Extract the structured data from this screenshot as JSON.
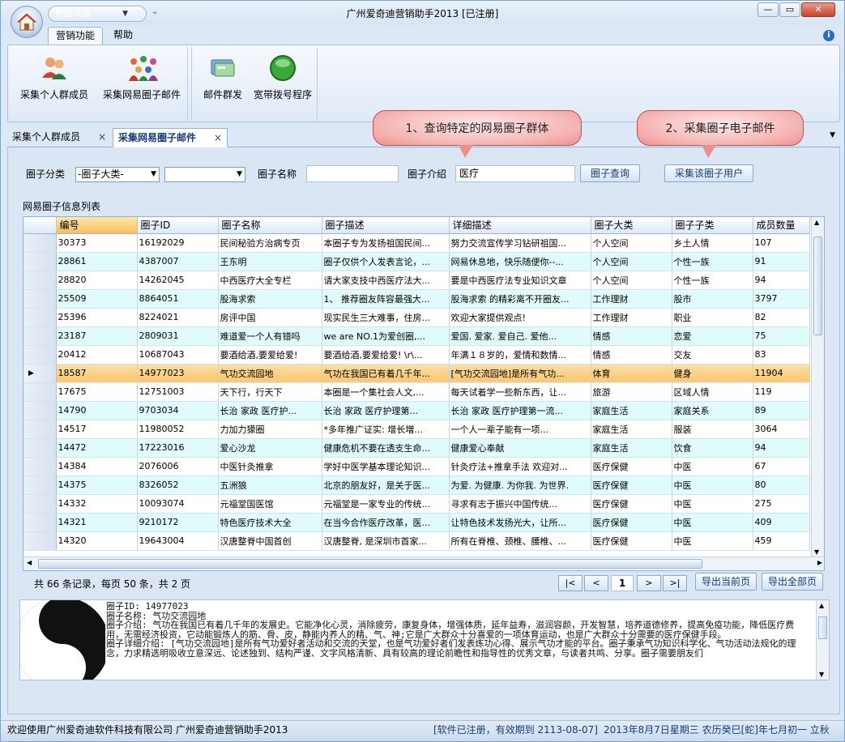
{
  "app": {
    "title": "广州爱奇迪营销助手2013 [已注册]",
    "qat_text": "界面风格"
  },
  "ribbon_tabs": [
    {
      "label": "营销功能",
      "active": true
    },
    {
      "label": "帮助",
      "active": false
    }
  ],
  "ribbon_buttons": [
    {
      "label": "采集个人群成员",
      "icon": "people-icon"
    },
    {
      "label": "采集网易圈子邮件",
      "icon": "group-people-icon"
    },
    {
      "label": "邮件群发",
      "icon": "email-cards-icon"
    },
    {
      "label": "宽带拨号程序",
      "icon": "green-orb-icon"
    }
  ],
  "doc_tabs": [
    {
      "label": "采集个人群成员",
      "active": false
    },
    {
      "label": "采集网易圈子邮件",
      "active": true
    }
  ],
  "callouts": [
    "1、查询特定的网易圈子群体",
    "2、采集圈子电子邮件"
  ],
  "filters": {
    "category_label": "圈子分类",
    "category_value": "-圈子大类-",
    "subcategory_value": "",
    "name_label": "圈子名称",
    "name_value": "",
    "intro_label": "圈子介绍",
    "intro_value": "医疗",
    "query_button": "圈子查询",
    "collect_button": "采集该圈子用户"
  },
  "grid": {
    "title": "网易圈子信息列表",
    "columns": [
      "编号",
      "圈子ID",
      "圈子名称",
      "圈子描述",
      "详细描述",
      "圈子大类",
      "圈子子类",
      "成员数量"
    ],
    "rows": [
      [
        "30373",
        "16192029",
        "民间秘验方治病专页",
        "本圈子专为发扬祖国民间...",
        "努力交流宣传学习钻研祖国...",
        "个人空间",
        "乡土人情",
        "107"
      ],
      [
        "28861",
        "4387007",
        "王东明",
        "圈子仅供个人发表言论，...",
        "网易休息地，快乐随便你--...",
        "个人空间",
        "个性一族",
        "91"
      ],
      [
        "28820",
        "14262045",
        "中西医疗大全专栏",
        "请大家支技中西医疗法大...",
        "要是中西医疗法专业知识文章",
        "个人空间",
        "个性一族",
        "94"
      ],
      [
        "25509",
        "8864051",
        "股海求索",
        "1、 推荐圈友阵容最强大...",
        "股海求索 的精彩离不开圈友...",
        "工作理财",
        "股市",
        "3797"
      ],
      [
        "25396",
        "8224021",
        "房评中国",
        "现实民生三大难事，住房...",
        "欢迎大家提供观点!",
        "工作理财",
        "职业",
        "82"
      ],
      [
        "23187",
        "2809031",
        "难道爱一个人有错吗",
        "we  are  NO.1为爱创圈,...",
        "爱国. 爱家. 爱自己. 爱他...",
        "情感",
        "恋爱",
        "75"
      ],
      [
        "20412",
        "10687043",
        "要酒给酒,要爱给爱!",
        "要酒给酒,要爱给爱! \\r\\...",
        "年满１８岁的，爱情和数情...",
        "情感",
        "交友",
        "83"
      ],
      [
        "18587",
        "14977023",
        "气功交流园地",
        "气功在我国已有着几千年...",
        "[气功交流园地]是所有气功...",
        "体育",
        "健身",
        "11904"
      ],
      [
        "17675",
        "12751003",
        "天下行，行天下",
        "本圈是一个集社会人文,...",
        "每天试着学一些新东西，让...",
        "旅游",
        "区域人情",
        "119"
      ],
      [
        "14790",
        "9703034",
        "长治 家政 医疗护...",
        "长治 家政 医疗护理第...",
        "长治 家政 医疗护理第一流...",
        "家庭生活",
        "家庭关系",
        "89"
      ],
      [
        "14517",
        "11980052",
        "力加力獴圈",
        "*多年推广证实: 增长増...",
        "    一个人一辈子能有一项...",
        "家庭生活",
        "服装",
        "3064"
      ],
      [
        "14472",
        "17223016",
        "爱心沙龙",
        "健康危机不要在透支生命...",
        "健康爱心奉献",
        "家庭生活",
        "饮食",
        "94"
      ],
      [
        "14384",
        "2076006",
        " 中医针灸推拿",
        "学好中医学基本理论知识...",
        "针灸疗法+推拿手法 欢迎对...",
        "医疗保健",
        "中医",
        "67"
      ],
      [
        "14375",
        "8326052",
        "五洲狼",
        "北京的朋友好，是关于医...",
        "为爱. 为健康. 为你我. 为世界.",
        "医疗保健",
        "中医",
        "80"
      ],
      [
        "14332",
        "10093074",
        "元福堂国医馆",
        "元福堂是一家专业的传统...",
        "寻求有志于振兴中国传统...",
        "医疗保健",
        "中医",
        "275"
      ],
      [
        "14321",
        "9210172",
        "特色医疗技术大全",
        "在当今合作医疗改革，医...",
        "让特色技术发扬光大，让所...",
        "医疗保健",
        "中医",
        "409"
      ],
      [
        "14320",
        "19643004",
        "汉唐整脊中国首创",
        "汉唐整脊, 是深圳市首家...",
        "所有在脊椎、颈椎、腰椎、...",
        "医疗保健",
        "中医",
        "459"
      ]
    ],
    "selected_row": 7
  },
  "pager": {
    "summary": "共 66 条记录，每页 50 条，共 2 页",
    "current_page": "1",
    "first": "|<",
    "prev": "<",
    "next": ">",
    "last": ">|",
    "export_current": "导出当前页",
    "export_all": "导出全部页"
  },
  "detail": {
    "line1": "圈子ID: 14977023",
    "line2": "圈子名称: 气功交流园地",
    "line3": "圈子介绍: 气功在我国已有着几千年的发展史。它能净化心灵，消除疲劳，康复身体，增强体质，延年益寿，滋润容颜，开发智慧，培养道德修养，提高免疫功能，降低医疗费用，无需经济投资，它动能锻炼人的筋、骨、皮，静能内养人的精、气、神;它是广大群众十分喜爱的一项体育运动，也是广大群众十分需要的医疗保健手段。",
    "line4": "圈子详细介绍: [气功交流园地]是所有气功爱好者活动和交流的天堂，也是气功爱好者们发表炼功心得、展示气功才能的平台。圈子秉承气功知识科学化、气功活动法规化的理念，力求精选明吸收立意深远、论述独到、结构严谨、文字风格清新、具有较高的理论前瞻性和指导性的优秀文章，与读者共鸣、分享。圈子需要朋友们"
  },
  "status": {
    "left": "欢迎使用广州爱奇迪软件科技有限公司 广州爱奇迪营销助手2013",
    "registered": "[软件已注册，有效期到 2113-08-07]",
    "date": "2013年8月7日星期三 农历癸巳[蛇]年七月初一 立秋"
  },
  "colors": {
    "accent": "#153c7a",
    "selected_row": "#f9c66f",
    "alt_row": "#dffcfb",
    "callout": "#ec8f8c"
  }
}
